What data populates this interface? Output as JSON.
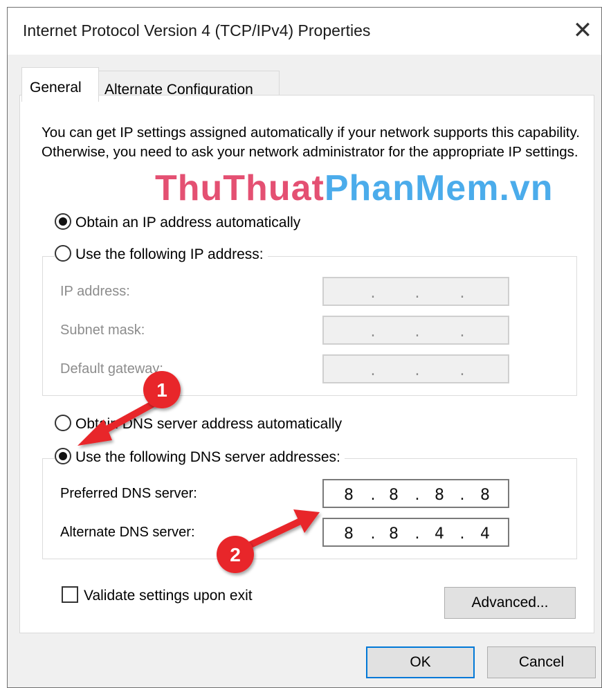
{
  "window": {
    "title": "Internet Protocol Version 4 (TCP/IPv4) Properties",
    "close_glyph": "✕"
  },
  "tabs": [
    {
      "label": "General",
      "active": true
    },
    {
      "label": "Alternate Configuration",
      "active": false
    }
  ],
  "description": "You can get IP settings assigned automatically if your network supports this capability. Otherwise, you need to ask your network administrator for the appropriate IP settings.",
  "watermark": {
    "part1": "ThuThuat",
    "part2": "PhanMem",
    "part3": ".vn"
  },
  "ip_section": {
    "auto_label": "Obtain an IP address automatically",
    "auto_selected": true,
    "manual_label": "Use the following IP address:",
    "manual_selected": false,
    "fields": [
      {
        "label": "IP address:",
        "octets": [
          "",
          "",
          "",
          ""
        ],
        "enabled": false
      },
      {
        "label": "Subnet mask:",
        "octets": [
          "",
          "",
          "",
          ""
        ],
        "enabled": false
      },
      {
        "label": "Default gateway:",
        "octets": [
          "",
          "",
          "",
          ""
        ],
        "enabled": false
      }
    ]
  },
  "dns_section": {
    "auto_label": "Obtain DNS server address automatically",
    "auto_selected": false,
    "manual_label": "Use the following DNS server addresses:",
    "manual_selected": true,
    "fields": [
      {
        "label": "Preferred DNS server:",
        "octets": [
          "8",
          "8",
          "8",
          "8"
        ],
        "enabled": true
      },
      {
        "label": "Alternate DNS server:",
        "octets": [
          "8",
          "8",
          "4",
          "4"
        ],
        "enabled": true
      }
    ]
  },
  "validate": {
    "label": "Validate settings upon exit",
    "checked": false
  },
  "buttons": {
    "advanced": "Advanced...",
    "ok": "OK",
    "cancel": "Cancel"
  },
  "annotations": [
    {
      "number": "1"
    },
    {
      "number": "2"
    }
  ],
  "colors": {
    "accent": "#0078d7",
    "annotation_red": "#e8262c",
    "watermark_red": "#e0325a",
    "watermark_blue": "#2c9ee8"
  }
}
